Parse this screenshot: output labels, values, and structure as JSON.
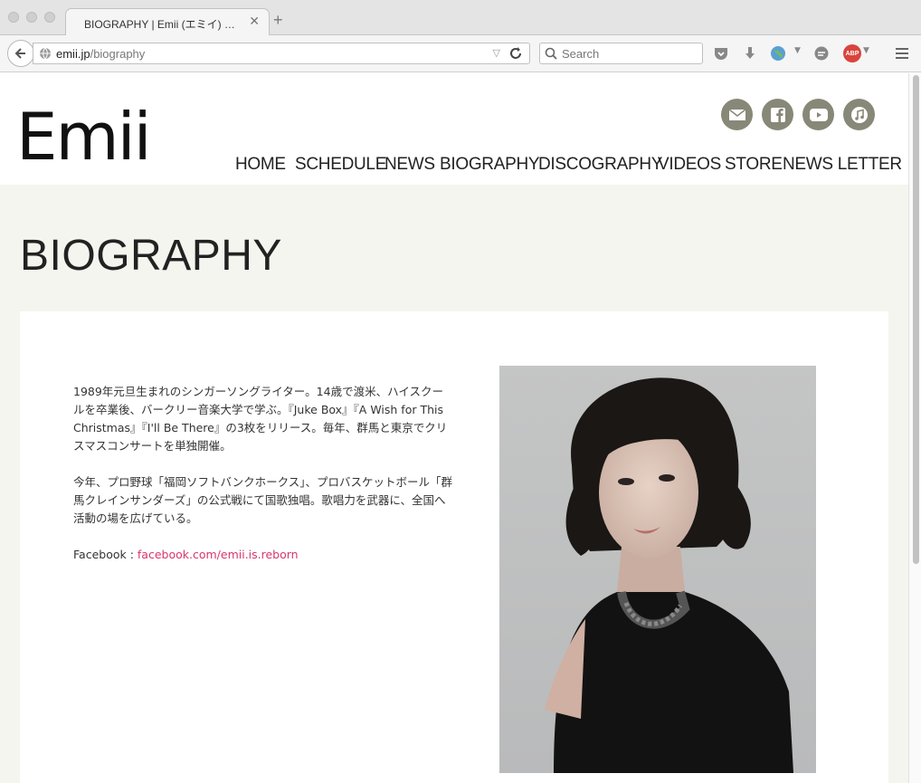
{
  "browser": {
    "tab_title": "BIOGRAPHY | Emii (エミイ) オフィ…",
    "url_domain": "emii.jp",
    "url_path": "/biography",
    "search_placeholder": "Search",
    "adblock_label": "ABP"
  },
  "site": {
    "logo": "Emii",
    "nav": [
      "HOME",
      "SCHEDULE",
      "NEWS",
      "BIOGRAPHY",
      "DISCOGRAPHY",
      "VIDEOS",
      "STORE",
      "NEWS LETTER"
    ],
    "social": [
      "mail-icon",
      "facebook-icon",
      "youtube-icon",
      "music-icon"
    ],
    "accent_color": "#d8366a",
    "social_color": "#888878"
  },
  "page": {
    "title": "BIOGRAPHY",
    "bio_paragraph_1": "1989年元旦生まれのシンガーソングライター。14歳で渡米、ハイスクールを卒業後、バークリー音楽大学で学ぶ。『Juke Box』『A Wish for This Christmas』『I'll Be There』の3枚をリリース。毎年、群馬と東京でクリスマスコンサートを単独開催。",
    "bio_paragraph_2": "今年、プロ野球「福岡ソフトバンクホークス」、プロバスケットボール「群馬クレインサンダーズ」の公式戦にて国歌独唱。歌唱力を武器に、全国へ活動の場を広げている。",
    "facebook_label": "Facebook : ",
    "facebook_link": "facebook.com/emii.is.reborn"
  }
}
